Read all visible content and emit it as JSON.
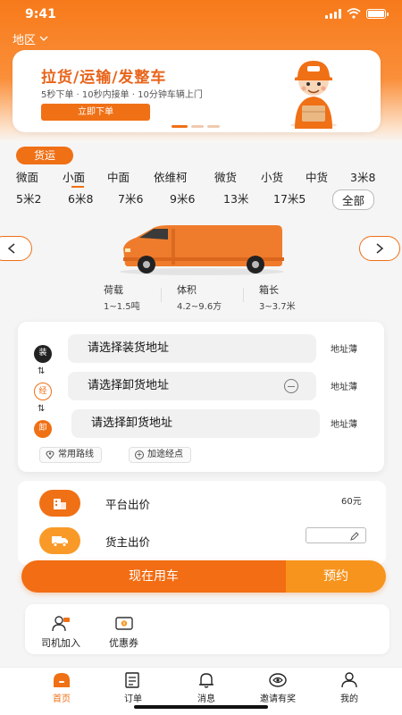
{
  "status_bar": {
    "time": "9:41"
  },
  "header": {
    "region_label": "地区"
  },
  "banner": {
    "title": "拉货/运输/发整车",
    "subtitle": "5秒下单 · 10秒内接单 · 10分钟车辆上门",
    "cta_label": "立即下单"
  },
  "service": {
    "active_tab": "货运"
  },
  "vehicle_types": {
    "row1": [
      "微面",
      "小面",
      "中面",
      "依维柯",
      "微货",
      "小货",
      "中货",
      "3米8"
    ],
    "row2": [
      "5米2",
      "6米8",
      "7米6",
      "9米6",
      "13米",
      "17米5"
    ],
    "all_label": "全部",
    "selected": "小面"
  },
  "vehicle_specs": [
    {
      "label": "荷载",
      "value": "1~1.5吨"
    },
    {
      "label": "体积",
      "value": "4.2~9.6方"
    },
    {
      "label": "箱长",
      "value": "3~3.7米"
    }
  ],
  "route": {
    "load_marker": "装",
    "via_marker": "经",
    "unload_marker": "卸",
    "load_placeholder": "请选择装货地址",
    "via_placeholder": "请选择卸货地址",
    "unload_placeholder": "请选择卸货地址",
    "address_book_label": "地址薄",
    "swap_symbol": "⇅",
    "common_routes_label": "常用路线",
    "add_waypoint_label": "加途经点"
  },
  "pricing": {
    "platform_label": "平台出价",
    "platform_value": "60元",
    "owner_label": "货主出价"
  },
  "actions": {
    "use_now_label": "现在用车",
    "reserve_label": "预约"
  },
  "extras": [
    {
      "label": "司机加入"
    },
    {
      "label": "优惠券"
    }
  ],
  "tabbar": {
    "items": [
      {
        "label": "首页",
        "icon": "home-icon"
      },
      {
        "label": "订单",
        "icon": "order-icon"
      },
      {
        "label": "消息",
        "icon": "bell-icon"
      },
      {
        "label": "邀请有奖",
        "icon": "invite-icon"
      },
      {
        "label": "我的",
        "icon": "user-icon"
      }
    ],
    "active": "首页"
  },
  "colors": {
    "accent": "#f07015",
    "accent_light": "#f7941d"
  }
}
